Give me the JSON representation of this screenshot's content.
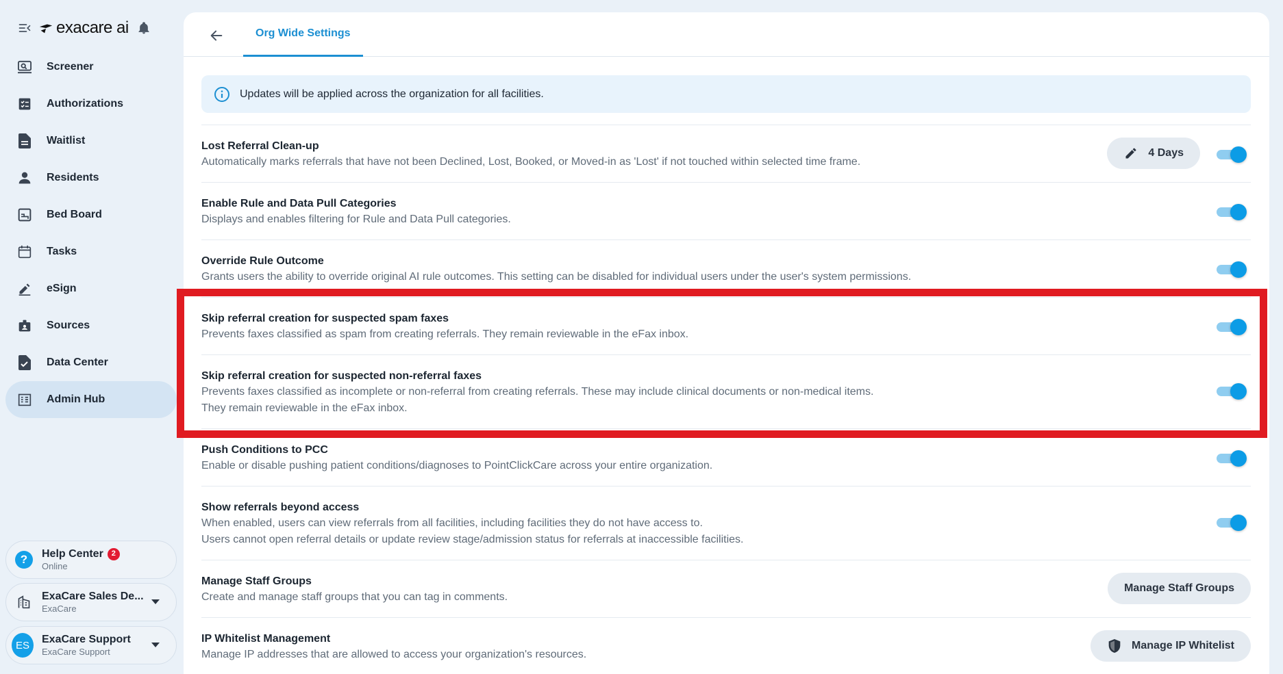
{
  "brand": {
    "name": "exacare ai"
  },
  "sidebar": {
    "items": [
      {
        "label": "Screener",
        "icon": "screener-icon"
      },
      {
        "label": "Authorizations",
        "icon": "checklist-icon"
      },
      {
        "label": "Waitlist",
        "icon": "document-icon"
      },
      {
        "label": "Residents",
        "icon": "person-icon"
      },
      {
        "label": "Bed Board",
        "icon": "bed-icon"
      },
      {
        "label": "Tasks",
        "icon": "calendar-icon"
      },
      {
        "label": "eSign",
        "icon": "signature-icon"
      },
      {
        "label": "Sources",
        "icon": "id-badge-icon"
      },
      {
        "label": "Data Center",
        "icon": "document-check-icon"
      },
      {
        "label": "Admin Hub",
        "icon": "building-icon",
        "active": true
      }
    ],
    "help": {
      "title": "Help Center",
      "badge": "2",
      "status": "Online"
    },
    "org": {
      "title": "ExaCare Sales De...",
      "sub": "ExaCare"
    },
    "user": {
      "initials": "ES",
      "title": "ExaCare Support",
      "sub": "ExaCare Support"
    }
  },
  "header": {
    "tab_label": "Org Wide Settings"
  },
  "banner": {
    "text": "Updates will be applied across the organization for all facilities."
  },
  "settings": [
    {
      "title": "Lost Referral Clean-up",
      "desc1": "Automatically marks referrals that have not been Declined, Lost, Booked, or Moved-in as 'Lost' if not touched within selected time frame.",
      "button": "4 Days",
      "enabled": true
    },
    {
      "title": "Enable Rule and Data Pull Categories",
      "desc1": "Displays and enables filtering for Rule and Data Pull categories.",
      "enabled": true
    },
    {
      "title": "Override Rule Outcome",
      "desc1": "Grants users the ability to override original AI rule outcomes. This setting can be disabled for individual users under the user's system permissions.",
      "enabled": true
    },
    {
      "title": "Skip referral creation for suspected spam faxes",
      "desc1": "Prevents faxes classified as spam from creating referrals. They remain reviewable in the eFax inbox.",
      "enabled": true
    },
    {
      "title": "Skip referral creation for suspected non-referral faxes",
      "desc1": "Prevents faxes classified as incomplete or non-referral from creating referrals. These may include clinical documents or non-medical items.",
      "desc2": "They remain reviewable in the eFax inbox.",
      "enabled": true
    },
    {
      "title": "Push Conditions to PCC",
      "desc1": "Enable or disable pushing patient conditions/diagnoses to PointClickCare across your entire organization.",
      "enabled": true
    },
    {
      "title": "Show referrals beyond access",
      "desc1": "When enabled, users can view referrals from all facilities, including facilities they do not have access to.",
      "desc2": "Users cannot open referral details or update review stage/admission status for referrals at inaccessible facilities.",
      "enabled": true
    },
    {
      "title": "Manage Staff Groups",
      "desc1": "Create and manage staff groups that you can tag in comments.",
      "button": "Manage Staff Groups"
    },
    {
      "title": "IP Whitelist Management",
      "desc1": "Manage IP addresses that are allowed to access your organization's resources.",
      "button": "Manage IP Whitelist"
    }
  ],
  "colors": {
    "accent": "#1c8fd2",
    "toggle_on": "#0c9ce6",
    "highlight": "#e01b21",
    "badge": "#e21b32"
  }
}
